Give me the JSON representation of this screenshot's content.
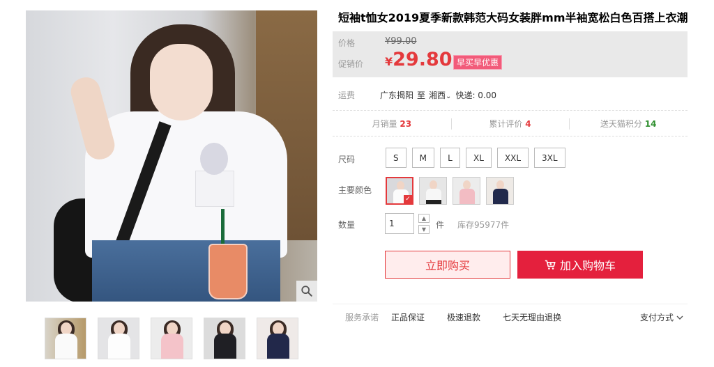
{
  "product": {
    "title": "短袖t恤女2019夏季新款韩范大码女装胖mm半袖宽松白色百搭上衣潮"
  },
  "price": {
    "original_label": "价格",
    "original_value": "¥99.00",
    "promo_label": "促销价",
    "currency": "¥",
    "promo_value": "29.80",
    "promo_tag": "早买早优惠",
    "accent_color": "#e4393c"
  },
  "shipping": {
    "label": "运费",
    "from": "广东揭阳",
    "to_word": "至",
    "to": "湘西",
    "express": "快递: 0.00"
  },
  "stats": {
    "monthly_sales_label": "月销量",
    "monthly_sales_value": "23",
    "reviews_label": "累计评价",
    "reviews_value": "4",
    "points_label": "送天猫积分",
    "points_value": "14"
  },
  "size": {
    "label": "尺码",
    "options": [
      "S",
      "M",
      "L",
      "XL",
      "XXL",
      "3XL"
    ]
  },
  "color": {
    "label": "主要颜色",
    "swatches": [
      "white",
      "white-black-print",
      "pink",
      "navy"
    ]
  },
  "quantity": {
    "label": "数量",
    "value": "1",
    "unit": "件",
    "stock": "库存95977件"
  },
  "actions": {
    "buy_now": "立即购买",
    "add_to_cart": "加入购物车"
  },
  "service": {
    "label": "服务承诺",
    "items": [
      "正品保证",
      "极速退款",
      "七天无理由退换"
    ],
    "payment": "支付方式"
  },
  "icons": {
    "zoom": "magnifier-icon",
    "cart": "cart-icon",
    "chevron": "chevron-down-icon"
  }
}
